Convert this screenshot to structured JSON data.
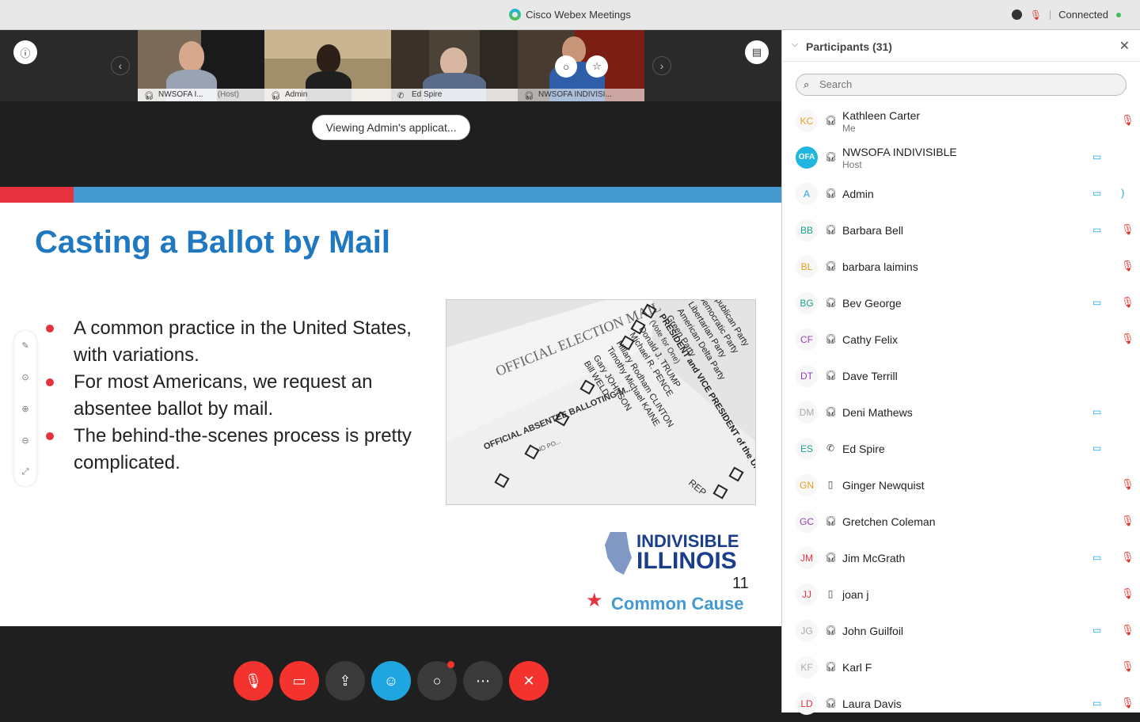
{
  "window": {
    "title": "Cisco Webex Meetings",
    "connection_status": "Connected"
  },
  "filmstrip": {
    "thumbnails": [
      {
        "name": "NWSOFA I...",
        "role": "(Host)",
        "icon": "headset-icon"
      },
      {
        "name": "Admin",
        "role": "",
        "icon": "headset-icon"
      },
      {
        "name": "Ed Spire",
        "role": "",
        "icon": "phone-icon"
      },
      {
        "name": "NWSOFA INDIVISI...",
        "role": "",
        "icon": "headset-icon"
      }
    ]
  },
  "share": {
    "viewing_label": "Viewing Admin's applicat..."
  },
  "slide": {
    "title": "Casting a Ballot by Mail",
    "bullets": [
      "A common practice in the United States, with variations.",
      "For most Americans, we request an absentee ballot by mail.",
      "The behind-the-scenes process is pretty complicated."
    ],
    "ballot_image_texts": {
      "election_mail": "OFFICIAL ELECTION MAIL",
      "absentee": "OFFICIAL ABSENTEE BALLOTING M...",
      "president": "PRESIDENT and VICE PRESIDENT of the UNITED STATES",
      "vote_for": "(Vote for One)",
      "parties": [
        "Republican Party",
        "Democratic Party",
        "Libertarian Party",
        "American Delta Party",
        "Green Party"
      ],
      "candidates": [
        "Donald J. TRUMP",
        "Michael R. PENCE",
        "Hillary Rodham CLINTON",
        "Timothy Michael KAINE",
        "Gary JOHNSON",
        "Bill WELD"
      ],
      "rep": "REP",
      "no_po": "NO PO..."
    },
    "logo_indivisible": "INDIVISIBLE",
    "logo_illinois": "ILLINOIS",
    "page_number": "11",
    "logo_common_cause": "Common Cause"
  },
  "panel": {
    "title": "Participants (31)",
    "search_placeholder": "Search",
    "participants": [
      {
        "initials": "KC",
        "color": "#e8a020",
        "name": "Kathleen Carter",
        "sub": "Me",
        "conn": "headset",
        "video": false,
        "muted": true
      },
      {
        "initials": "OFA",
        "color": "#ffffff",
        "name": "NWSOFA INDIVISIBLE",
        "sub": "Host",
        "conn": "headset",
        "video": true,
        "muted": false
      },
      {
        "initials": "A",
        "color": "#1fa6e0",
        "name": "Admin",
        "sub": "",
        "conn": "headset",
        "video": true,
        "muted": false,
        "speaking": true
      },
      {
        "initials": "BB",
        "color": "#1aa38c",
        "name": "Barbara Bell",
        "sub": "",
        "conn": "headset",
        "video": true,
        "muted": true
      },
      {
        "initials": "BL",
        "color": "#e8a020",
        "name": "barbara laimins",
        "sub": "",
        "conn": "headset",
        "video": false,
        "muted": true
      },
      {
        "initials": "BG",
        "color": "#1aa38c",
        "name": "Bev George",
        "sub": "",
        "conn": "headset",
        "video": true,
        "muted": true
      },
      {
        "initials": "CF",
        "color": "#9b3fb5",
        "name": "Cathy Felix",
        "sub": "",
        "conn": "headset",
        "video": false,
        "muted": true
      },
      {
        "initials": "DT",
        "color": "#9b3fb5",
        "name": "Dave Terrill",
        "sub": "",
        "conn": "headset",
        "video": false,
        "muted": false
      },
      {
        "initials": "DM",
        "color": "#aaaaaa",
        "name": "Deni Mathews",
        "sub": "",
        "conn": "headset",
        "video": true,
        "muted": false
      },
      {
        "initials": "ES",
        "color": "#1aa38c",
        "name": "Ed Spire",
        "sub": "",
        "conn": "phone",
        "video": true,
        "muted": false
      },
      {
        "initials": "GN",
        "color": "#e8a020",
        "name": "Ginger Newquist",
        "sub": "",
        "conn": "mobile",
        "video": false,
        "muted": true
      },
      {
        "initials": "GC",
        "color": "#9b3fb5",
        "name": "Gretchen Coleman",
        "sub": "",
        "conn": "headset",
        "video": false,
        "muted": true
      },
      {
        "initials": "JM",
        "color": "#e5323e",
        "name": "Jim McGrath",
        "sub": "",
        "conn": "headset",
        "video": true,
        "muted": true
      },
      {
        "initials": "JJ",
        "color": "#e5323e",
        "name": "joan j",
        "sub": "",
        "conn": "mobile",
        "video": false,
        "muted": true
      },
      {
        "initials": "JG",
        "color": "#aaaaaa",
        "name": "John Guilfoil",
        "sub": "",
        "conn": "headset",
        "video": true,
        "muted": true
      },
      {
        "initials": "KF",
        "color": "#aaaaaa",
        "name": "Karl F",
        "sub": "",
        "conn": "headset",
        "video": false,
        "muted": true
      },
      {
        "initials": "LD",
        "color": "#e5323e",
        "name": "Laura Davis",
        "sub": "",
        "conn": "headset",
        "video": true,
        "muted": true
      }
    ]
  }
}
